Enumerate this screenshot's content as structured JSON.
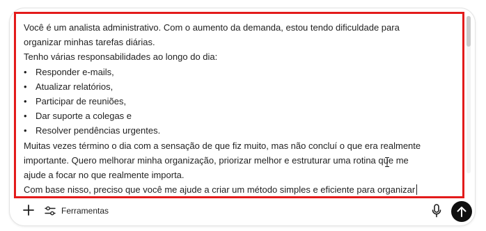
{
  "prompt": {
    "lines": [
      "Você é um analista administrativo. Com o aumento da demanda, estou tendo dificuldade para",
      "organizar minhas tarefas diárias.",
      "Tenho várias responsabilidades ao longo do dia:"
    ],
    "bullet_symbol": "•",
    "bullets": [
      "Responder e-mails,",
      "Atualizar relatórios,",
      "Participar de reuniões,",
      "Dar suporte a colegas e",
      "Resolver pendências urgentes."
    ],
    "after_lines": [
      "Muitas vezes término o dia com a sensação de que fiz muito, mas não concluí o que era realmente",
      "importante. Quero melhorar minha organização, priorizar melhor e estruturar uma rotina que me",
      "ajude a focar no que realmente importa.",
      "Com base nisso, preciso que você me ajude a criar um método simples e eficiente para organizar"
    ]
  },
  "toolbar": {
    "add_icon": "plus-icon",
    "tools_icon": "sliders-icon",
    "tools_label": "Ferramentas",
    "mic_icon": "microphone-icon",
    "send_icon": "arrow-up-icon"
  },
  "colors": {
    "highlight_border": "#e31b1b",
    "send_button": "#0f0f0f",
    "text": "#1f1f1f"
  }
}
